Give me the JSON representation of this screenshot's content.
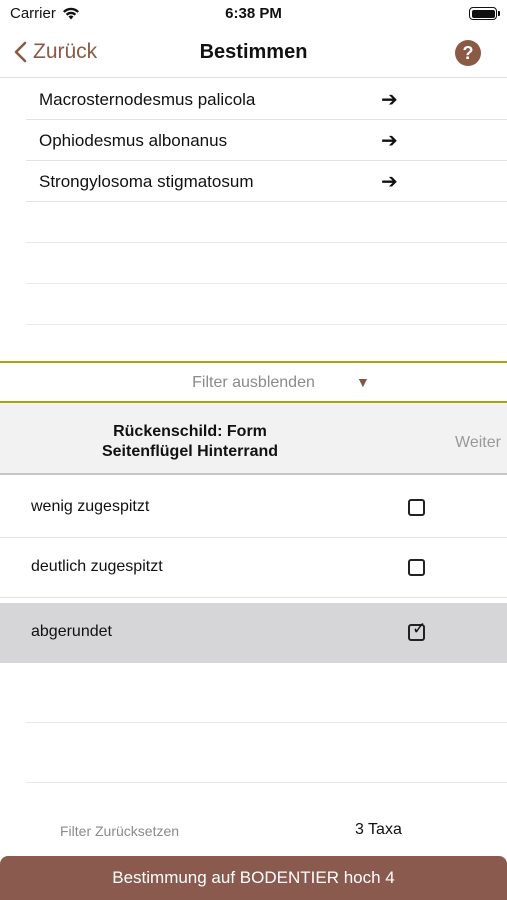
{
  "status_bar": {
    "carrier": "Carrier",
    "time": "6:38 PM"
  },
  "nav": {
    "back_label": "Zurück",
    "title": "Bestimmen",
    "help_label": "?"
  },
  "results": [
    {
      "name": "Macrosternodesmus palicola",
      "arrow": "➔"
    },
    {
      "name": "Ophiodesmus albonanus",
      "arrow": "➔"
    },
    {
      "name": "Strongylosoma stigmatosum",
      "arrow": "➔"
    }
  ],
  "filter_toggle": {
    "label": "Filter ausblenden",
    "indicator": "▼"
  },
  "criterion": {
    "title_line1": "Rückenschild: Form",
    "title_line2": "Seitenflügel Hinterrand",
    "next_label": "Weiter"
  },
  "options": [
    {
      "label": "wenig zugespitzt",
      "checked": false,
      "mark": ""
    },
    {
      "label": "deutlich zugespitzt",
      "checked": false,
      "mark": ""
    },
    {
      "label": "abgerundet",
      "checked": true,
      "mark": "✓"
    }
  ],
  "footer": {
    "reset_label": "Filter Zurücksetzen",
    "taxa_count": "3 Taxa",
    "determine_label": "Bestimmung auf BODENTIER hoch 4"
  },
  "colors": {
    "accent": "#8a5a44",
    "filter_border": "#a8a414",
    "selected_row": "#d6d6d8",
    "button_bg": "#8a5a4e"
  }
}
